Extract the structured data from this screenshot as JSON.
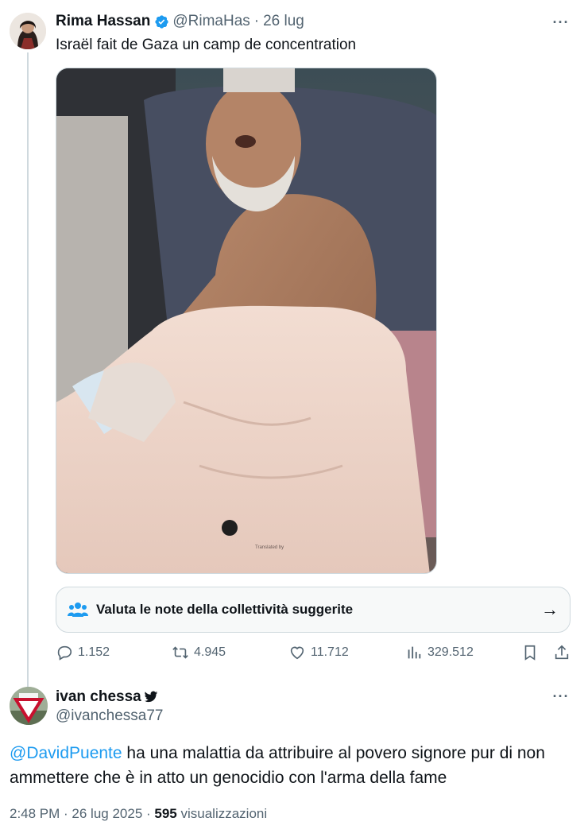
{
  "colors": {
    "accent": "#1d9bf0",
    "text": "#0f1419",
    "muted": "#536471",
    "border": "#cfd9de"
  },
  "tweet1": {
    "name": "Rima Hassan",
    "verified_icon": "verified-badge-icon",
    "handle": "@RimaHas",
    "dot": "·",
    "time": "26 lug",
    "text": "Israël fait de Gaza un camp de concentration",
    "media_watermark": "Translated by",
    "community_note": {
      "icon": "community-people-icon",
      "label": "Valuta le note della collettività suggerite",
      "arrow": "→"
    },
    "actions": {
      "replies": "1.152",
      "reposts": "4.945",
      "likes": "11.712",
      "views": "329.512"
    }
  },
  "tweet2": {
    "name": "ivan chessa",
    "handle": "@ivanchessa77",
    "mention": "@DavidPuente",
    "text": " ha una malattia da attribuire al povero signore pur di non ammettere che è in atto un genocidio con l'arma della fame",
    "meta": {
      "time": "2:48 PM · 26 lug 2025 · ",
      "views_count": "595",
      "views_label": " visualizzazioni"
    }
  },
  "more_icon": "···"
}
